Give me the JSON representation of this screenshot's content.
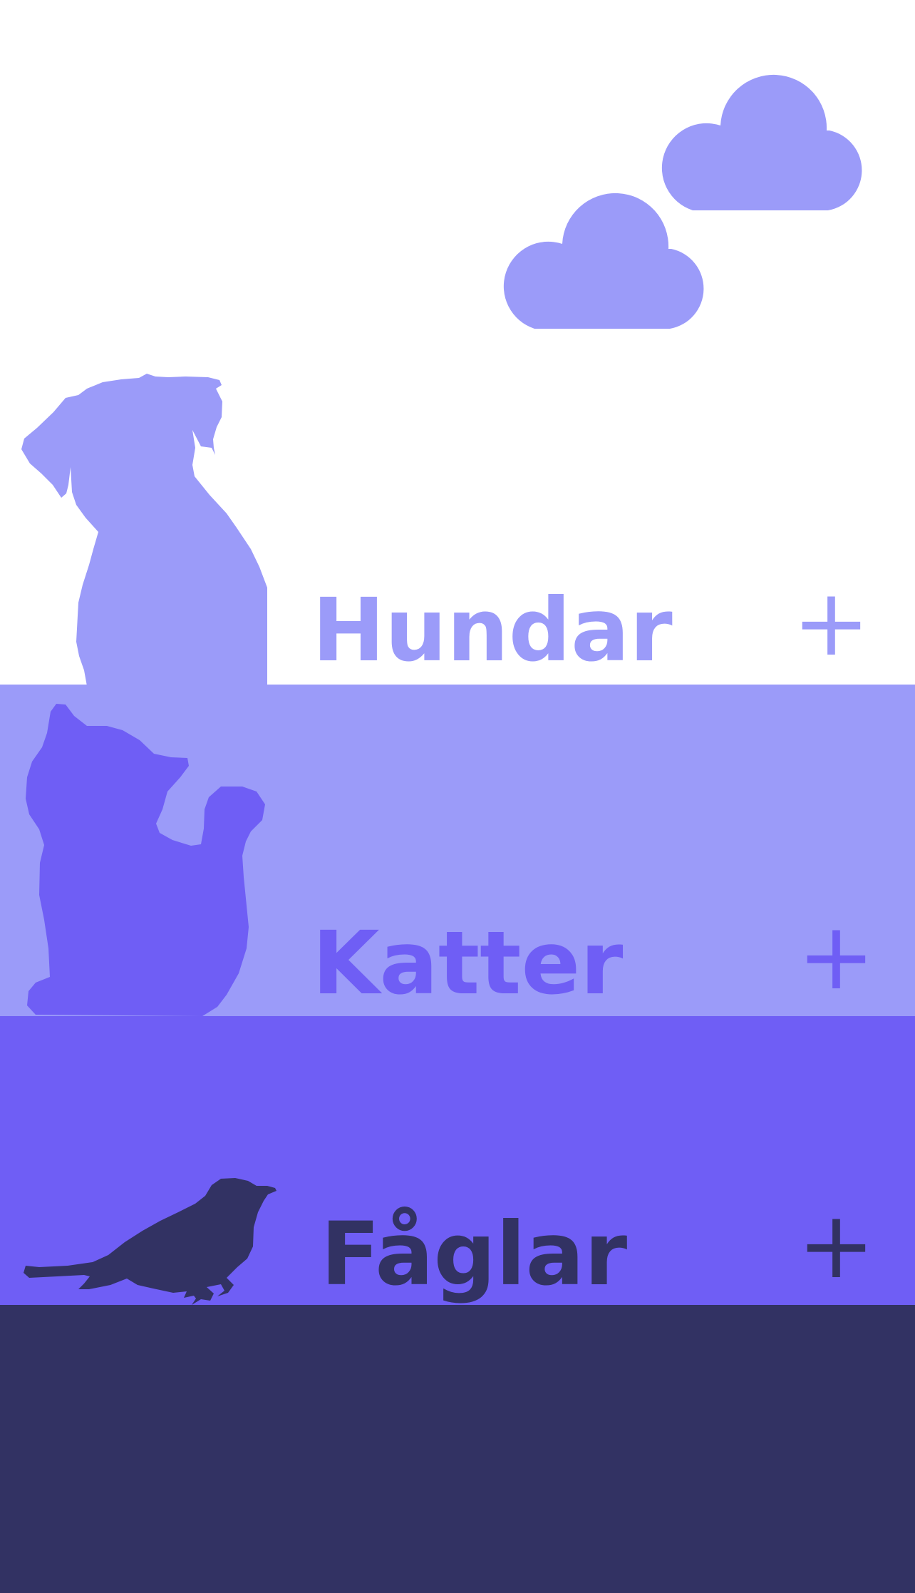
{
  "colors": {
    "background": "#ffffff",
    "light": "#9b9bf9",
    "medium": "#6f5ef5",
    "dark": "#323263"
  },
  "clouds": [
    "cloud-icon",
    "cloud-icon"
  ],
  "categories": [
    {
      "label": "Hundar",
      "icon": "dog-silhouette",
      "expand_icon": "plus-icon",
      "expand_symbol": "+"
    },
    {
      "label": "Katter",
      "icon": "cat-silhouette",
      "expand_icon": "plus-icon",
      "expand_symbol": "+"
    },
    {
      "label": "Fåglar",
      "icon": "bird-silhouette",
      "expand_icon": "plus-icon",
      "expand_symbol": "+"
    }
  ]
}
